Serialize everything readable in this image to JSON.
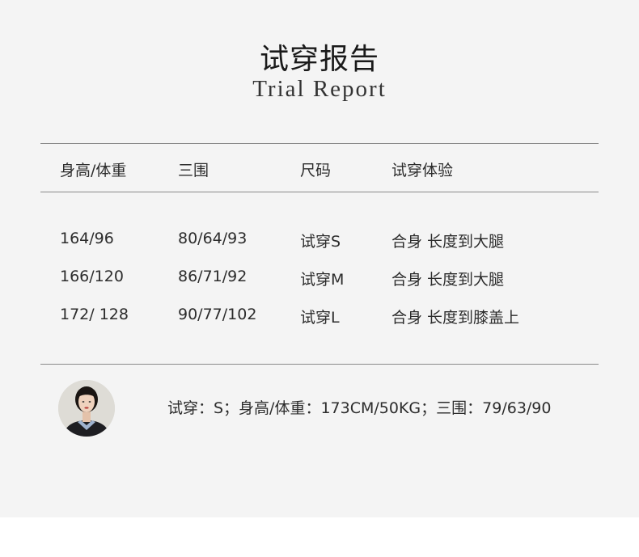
{
  "title": {
    "cn": "试穿报告",
    "en": "Trial Report"
  },
  "table": {
    "headers": [
      "身高/体重",
      "三围",
      "尺码",
      "试穿体验"
    ],
    "rows": [
      [
        "164/96",
        "80/64/93",
        "试穿S",
        "合身 长度到大腿"
      ],
      [
        "166/120",
        "86/71/92",
        "试穿M",
        "合身 长度到大腿"
      ],
      [
        "172/ 128",
        "90/77/102",
        "试穿L",
        "合身 长度到膝盖上"
      ]
    ]
  },
  "model": {
    "info": "试穿：S；身高/体重：173CM/50KG；三围：79/63/90"
  },
  "colors": {
    "panel_bg": "#f4f4f4",
    "rule": "#8a8a8a",
    "text": "#2c2c2c"
  }
}
